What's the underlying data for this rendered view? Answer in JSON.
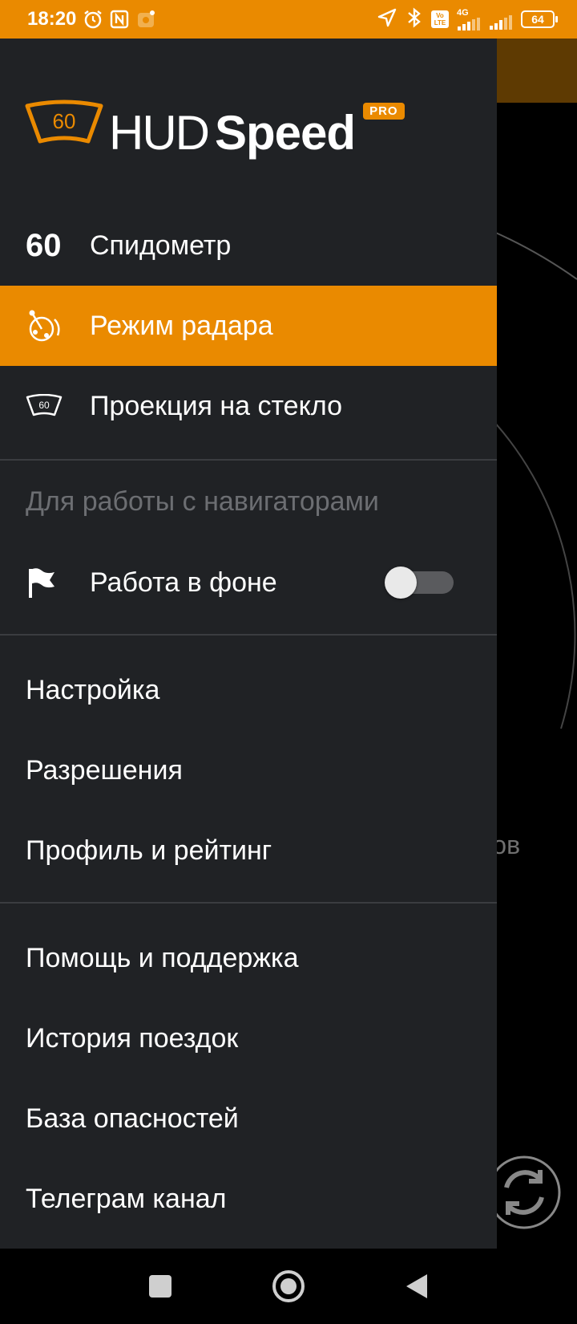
{
  "status_bar": {
    "time": "18:20",
    "battery": "64",
    "network": "4G",
    "volte": [
      "Vo",
      "LTE"
    ],
    "icons": [
      "alarm-icon",
      "nfc-icon",
      "notification-app-icon",
      "location-arrow-icon",
      "bluetooth-icon",
      "volte-icon",
      "signal-icon",
      "signal-icon",
      "battery-icon"
    ]
  },
  "background_app": {
    "partial_text": "тов"
  },
  "drawer": {
    "logo": {
      "badge_number": "60",
      "text_hud": "HUD",
      "text_speed": "Speed",
      "pro_badge": "PRO"
    },
    "main_items": [
      {
        "icon_text": "60",
        "label": "Спидометр",
        "active": false
      },
      {
        "icon": "radar-mode-icon",
        "label": "Режим радара",
        "active": true
      },
      {
        "icon": "windshield-projection-icon",
        "icon_text": "60",
        "label": "Проекция на стекло",
        "active": false
      }
    ],
    "nav_section": {
      "header": "Для работы с навигаторами",
      "background_item": {
        "icon": "flag-icon",
        "label": "Работа в фоне",
        "toggle_on": false
      }
    },
    "settings_items": [
      "Настройка",
      "Разрешения",
      "Профиль и рейтинг"
    ],
    "other_items": [
      "Помощь и поддержка",
      "История поездок",
      "База опасностей",
      "Телеграм канал"
    ]
  },
  "navbar": {
    "buttons": [
      "recents-square-icon",
      "home-circle-icon",
      "back-triangle-icon"
    ]
  },
  "colors": {
    "accent": "#EA8A00",
    "drawer_bg": "#202225",
    "divider": "#3a3c40",
    "muted_text": "#6c6e72"
  }
}
